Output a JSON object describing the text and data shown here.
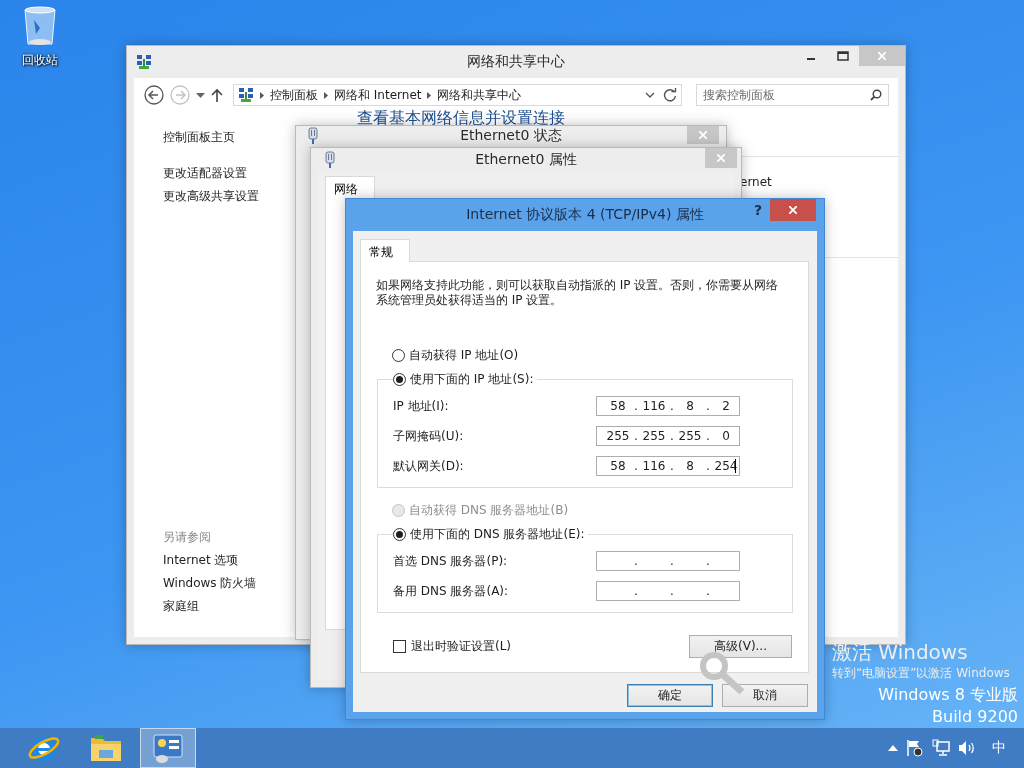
{
  "desktop": {
    "icons": [
      {
        "label": "回收站"
      }
    ]
  },
  "network_center": {
    "title": "网络和共享中心",
    "breadcrumb": [
      "控制面板",
      "网络和 Internet",
      "网络和共享中心"
    ],
    "search": {
      "placeholder": "搜索控制面板"
    },
    "sidebar": {
      "links": [
        "控制面板主页",
        "更改适配器设置",
        "更改高级共享设置"
      ],
      "see_also_title": "另请参阅",
      "see_also": [
        "Internet 选项",
        "Windows 防火墙",
        "家庭组"
      ]
    },
    "heading": "查看基本网络信息并设置连接",
    "fragment": "ernet"
  },
  "status_window": {
    "title": "Ethernet0 状态"
  },
  "properties_window": {
    "title": "Ethernet0 属性",
    "tabs": [
      {
        "label": "网络",
        "selected": true
      }
    ]
  },
  "ipv4_dialog": {
    "title": "Internet 协议版本 4 (TCP/IPv4) 属性",
    "help": "?",
    "tabs": [
      {
        "label": "常规",
        "selected": true
      }
    ],
    "description": "如果网络支持此功能，则可以获取自动指派的 IP 设置。否则，你需要从网络系统管理员处获得适当的 IP 设置。",
    "ip_mode": [
      {
        "label": "自动获得 IP 地址(O)",
        "selected": false,
        "disabled": false
      },
      {
        "label": "使用下面的 IP 地址(S):",
        "selected": true,
        "disabled": false
      }
    ],
    "ip_fields": [
      {
        "label": "IP 地址(I):",
        "parts": [
          "58",
          ".",
          "116",
          ".",
          "8",
          ".",
          "2"
        ],
        "focused": false
      },
      {
        "label": "子网掩码(U):",
        "parts": [
          "255",
          ".",
          "255",
          ".",
          "255",
          ".",
          "0"
        ],
        "focused": false
      },
      {
        "label": "默认网关(D):",
        "parts": [
          "58",
          ".",
          "116",
          ".",
          "8",
          ".",
          "254"
        ],
        "focused": true
      }
    ],
    "dns_mode": [
      {
        "label": "自动获得 DNS 服务器地址(B)",
        "selected": false,
        "disabled": true
      },
      {
        "label": "使用下面的 DNS 服务器地址(E):",
        "selected": true,
        "disabled": false
      }
    ],
    "dns_fields": [
      {
        "label": "首选 DNS 服务器(P):",
        "parts": [
          ".",
          ".",
          "."
        ],
        "focused": false
      },
      {
        "label": "备用 DNS 服务器(A):",
        "parts": [
          ".",
          ".",
          "."
        ],
        "focused": false
      }
    ],
    "validate": {
      "label": "退出时验证设置(L)",
      "checked": false
    },
    "advanced_button": "高级(V)...",
    "buttons": [
      {
        "label": "确定",
        "default": true
      },
      {
        "label": "取消",
        "default": false
      }
    ]
  },
  "activation": {
    "title": "激活 Windows",
    "subtitle": "转到“电脑设置”以激活 Windows"
  },
  "edition": [
    "Windows 8 专业版",
    "Build 9200"
  ],
  "taskbar": {
    "apps": [
      {
        "kind": "ie",
        "selected": false
      },
      {
        "kind": "explorer",
        "selected": false
      },
      {
        "kind": "control-panel",
        "selected": true
      }
    ],
    "tray": {
      "language": "中"
    }
  }
}
